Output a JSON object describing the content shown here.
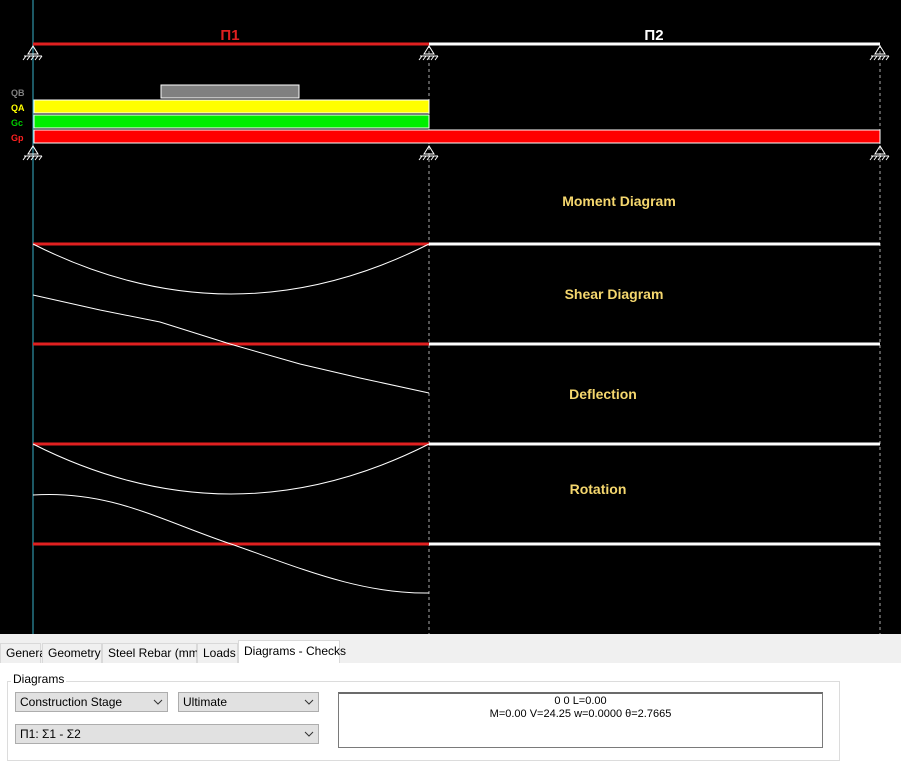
{
  "spans": [
    {
      "label": "Π1",
      "color": "#e02020"
    },
    {
      "label": "Π2",
      "color": "#ffffff"
    }
  ],
  "load_labels": [
    {
      "label": "QB",
      "color": "#808080"
    },
    {
      "label": "QA",
      "color": "#ffff00"
    },
    {
      "label": "Gc",
      "color": "#00cc00"
    },
    {
      "label": "Gp",
      "color": "#ff2020"
    }
  ],
  "diagram_titles": {
    "moment": "Moment Diagram",
    "shear": "Shear Diagram",
    "deflection": "Deflection",
    "rotation": "Rotation",
    "color": "#f5d76e"
  },
  "tabs": [
    {
      "label": "General",
      "active": false
    },
    {
      "label": "Geometry",
      "active": false
    },
    {
      "label": "Steel Rebar (mm)",
      "active": false
    },
    {
      "label": "Loads",
      "active": false
    },
    {
      "label": "Diagrams - Checks",
      "active": true
    }
  ],
  "panel": {
    "group_label": "Diagrams",
    "stage_select": "Construction Stage",
    "state_select": "Ultimate",
    "span_select": "Π1: Σ1 - Σ2",
    "info_line1": "0 0 L=0.00",
    "info_line2": "M=0.00 V=24.25 w=0.0000 θ=2.7665"
  }
}
